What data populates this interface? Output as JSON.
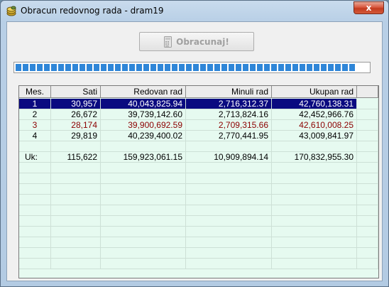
{
  "window": {
    "title": "Obracun redovnog rada - dram19",
    "close_label": "x"
  },
  "toolbar": {
    "calc_label": "Obracunaj!"
  },
  "progress": {
    "value": 1.0,
    "segments": 48,
    "color": "#2f86d8"
  },
  "table": {
    "columns": [
      "Mes.",
      "Sati",
      "Redovan rad",
      "Minuli rad",
      "Ukupan rad"
    ],
    "rows": [
      [
        "1",
        "30,957",
        "40,043,825.94",
        "2,716,312.37",
        "42,760,138.31"
      ],
      [
        "2",
        "26,672",
        "39,739,142.60",
        "2,713,824.16",
        "42,452,966.76"
      ],
      [
        "3",
        "28,174",
        "39,900,692.59",
        "2,709,315.66",
        "42,610,008.25"
      ],
      [
        "4",
        "29,819",
        "40,239,400.02",
        "2,770,441.95",
        "43,009,841.97"
      ]
    ],
    "total": [
      "Uk:",
      "115,622",
      "159,923,061.15",
      "10,909,894.14",
      "170,832,955.30"
    ],
    "selected_row": 0,
    "highlight_row": 2,
    "colors": {
      "selection": "#0a0a80",
      "highlight_text": "#8b0000",
      "background": "#e6faf0"
    }
  }
}
